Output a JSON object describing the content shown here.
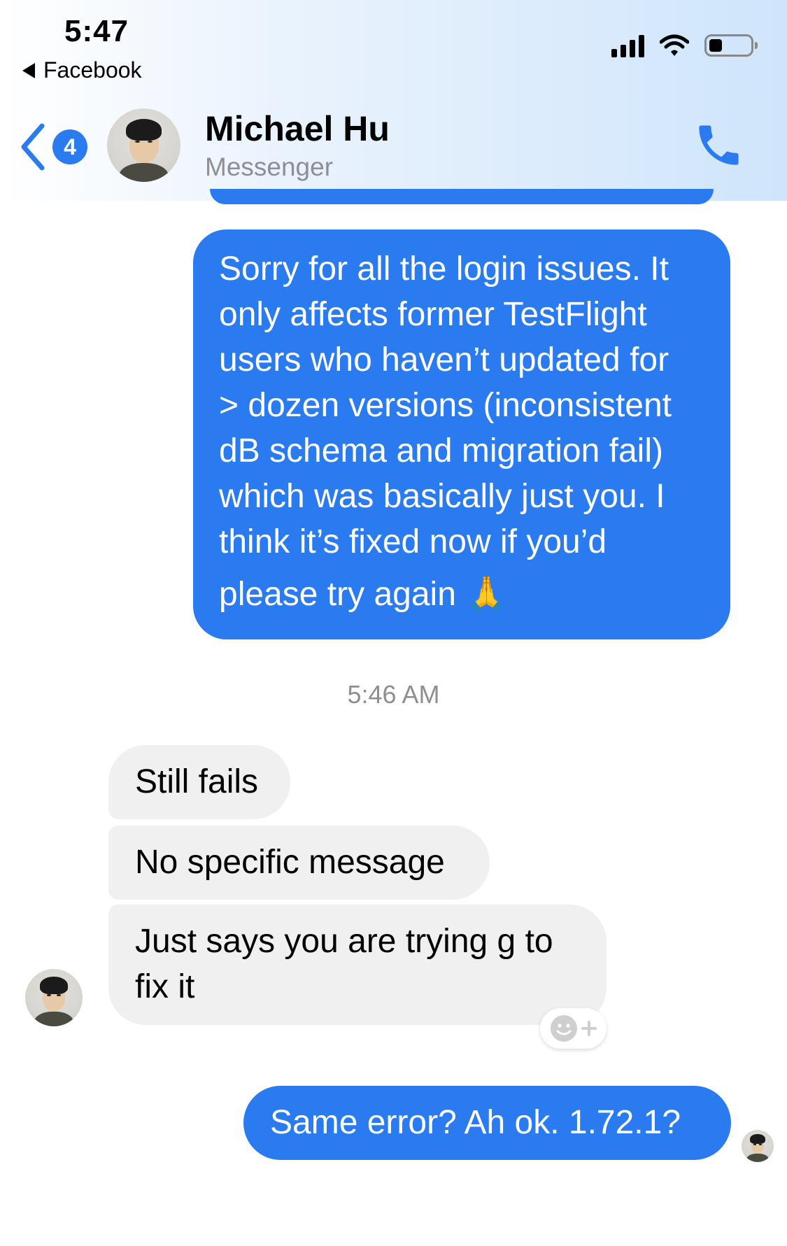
{
  "status_bar": {
    "time": "5:47",
    "back_app": "Facebook"
  },
  "header": {
    "unread_count": "4",
    "contact_name": "Michael Hu",
    "contact_subtitle": "Messenger",
    "icons": [
      "back-chevron-icon",
      "phone-icon",
      "signal-icon",
      "wifi-icon",
      "battery-icon"
    ]
  },
  "messages": {
    "outgoing_1": {
      "lines": [
        "Sorry for all the login issues.  It",
        "only affects former TestFlight",
        "users who haven’t updated for",
        "> dozen versions (inconsistent",
        "dB schema and migration fail)",
        "which was basically just you.  I",
        "think it’s fixed now if you’d",
        "please try again"
      ],
      "emoji": "🙏"
    },
    "timestamp": "5:46 AM",
    "incoming_1": "Still fails",
    "incoming_2": "No specific message",
    "incoming_3": {
      "lines": [
        "Just says you are trying g to",
        "fix it"
      ]
    },
    "outgoing_2": "Same error?  Ah ok.  1.72.1?"
  },
  "colors": {
    "accent": "#2a7af0",
    "incoming_bubble": "#f0f0f0",
    "secondary_text": "#8e8e93"
  }
}
